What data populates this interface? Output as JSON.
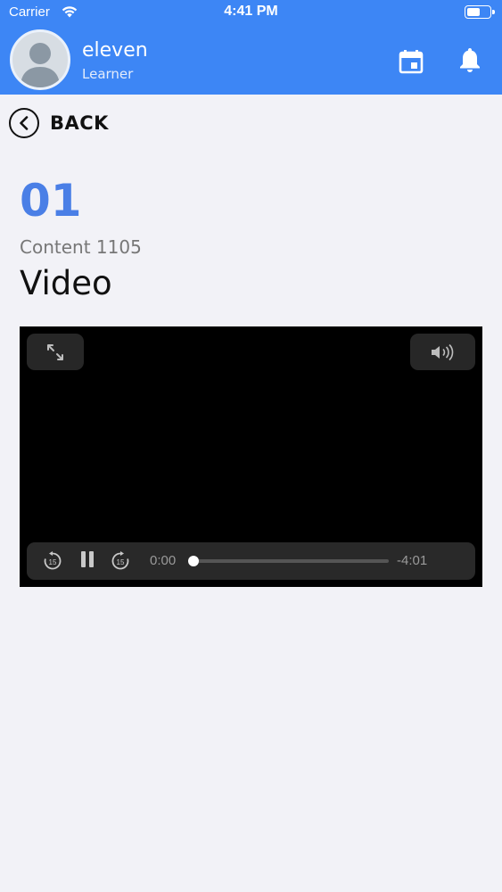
{
  "status_bar": {
    "carrier": "Carrier",
    "time": "4:41 PM",
    "battery_level": 0.55
  },
  "header": {
    "user_name": "eleven",
    "user_role": "Learner",
    "icons": [
      "avatar",
      "calendar-icon",
      "bell-icon"
    ],
    "background_color": "#3d86f5"
  },
  "nav": {
    "back_label": "BACK"
  },
  "content": {
    "number": "01",
    "subtitle": "Content 1105",
    "title": "Video",
    "number_color": "#4a7fe6"
  },
  "player": {
    "elapsed": "0:00",
    "remaining": "-4:01",
    "progress": 0.0,
    "skip_seconds": "15",
    "state": "playing"
  }
}
